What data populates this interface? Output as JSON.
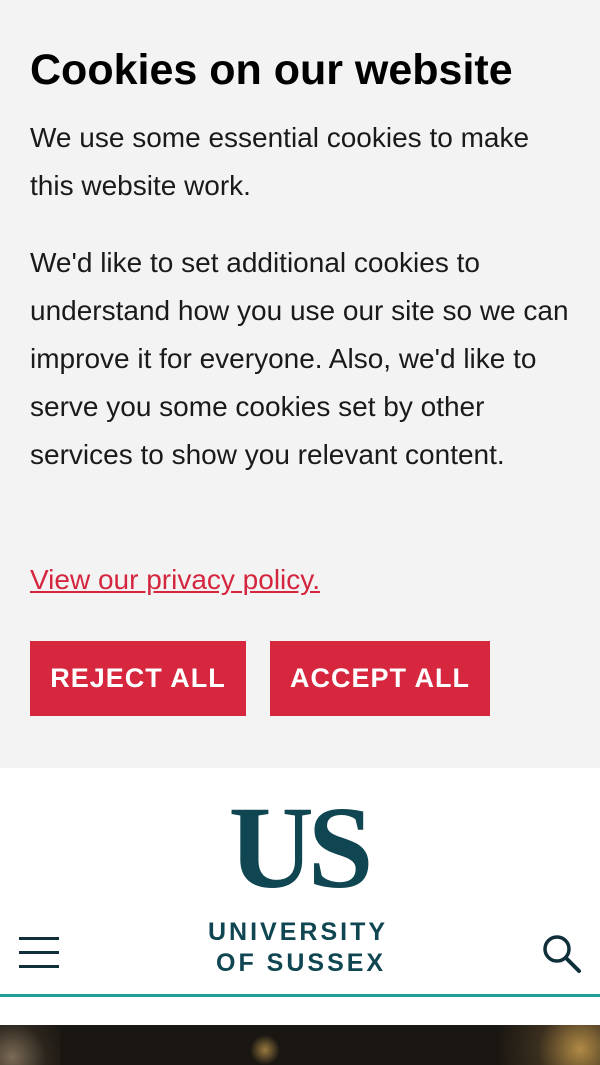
{
  "cookie_banner": {
    "title": "Cookies on our website",
    "paragraph1": "We use some essential cookies to make this website work.",
    "paragraph2": "We'd like to set additional cookies to understand how you use our site so we can improve it for everyone. Also, we'd like to serve you some cookies set by other services to show you relevant content.",
    "privacy_link": "View our privacy policy.",
    "reject_label": "REJECT ALL",
    "accept_label": "ACCEPT ALL"
  },
  "header": {
    "logo_monogram": "US",
    "logo_line1": "UNIVERSITY",
    "logo_line2": "OF SUSSEX",
    "menu_icon": "hamburger-menu-icon",
    "search_icon": "search-icon"
  },
  "colors": {
    "banner_bg": "#f3f3f4",
    "accent_red": "#d6273f",
    "brand_teal": "#0f4651",
    "header_rule": "#1f9e9a"
  }
}
